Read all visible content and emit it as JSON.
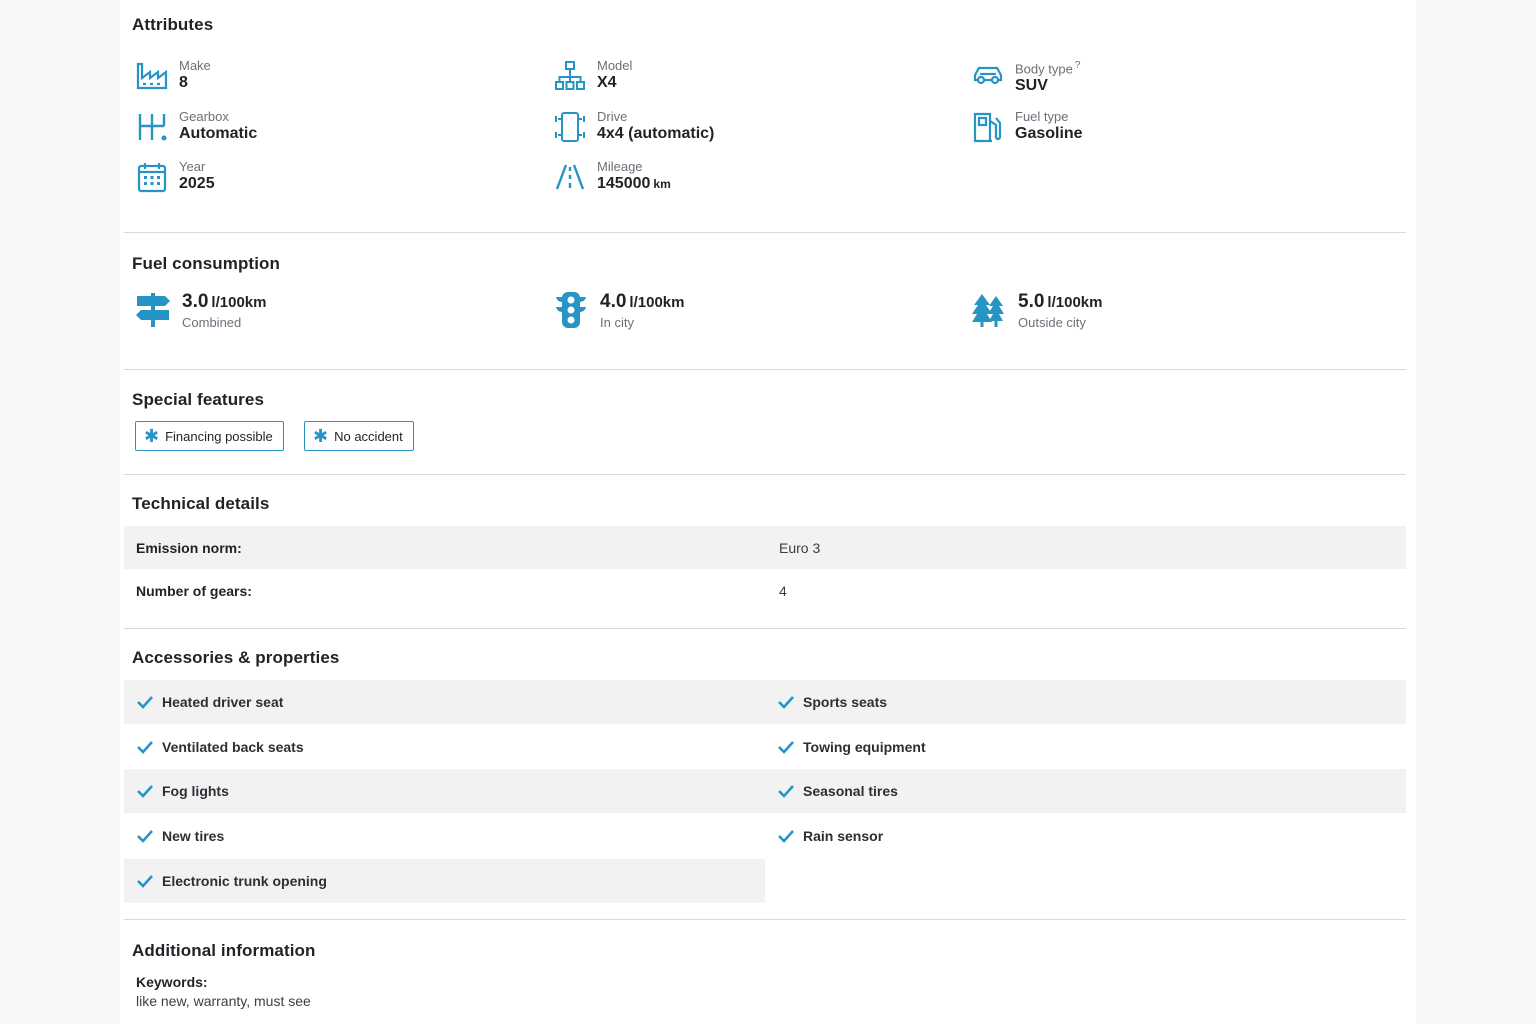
{
  "colors": {
    "accent": "#2694c4",
    "shade": "#f2f2f2",
    "divider": "#d6d9dd"
  },
  "attributes": {
    "title": "Attributes",
    "items": [
      {
        "icon": "factory-icon",
        "label": "Make",
        "value": "8"
      },
      {
        "icon": "hierarchy-icon",
        "label": "Model",
        "value": "X4"
      },
      {
        "icon": "car-icon",
        "label": "Body type",
        "value": "SUV",
        "help": "?"
      },
      {
        "icon": "gearbox-icon",
        "label": "Gearbox",
        "value": "Automatic"
      },
      {
        "icon": "drive-icon",
        "label": "Drive",
        "value": "4x4 (automatic)"
      },
      {
        "icon": "fuel-pump-icon",
        "label": "Fuel type",
        "value": "Gasoline"
      },
      {
        "icon": "calendar-icon",
        "label": "Year",
        "value": "2025"
      },
      {
        "icon": "road-icon",
        "label": "Mileage",
        "value": "145000",
        "unit": "km"
      }
    ]
  },
  "fuel": {
    "title": "Fuel consumption",
    "items": [
      {
        "icon": "signpost-icon",
        "value": "3.0",
        "unit": "l/100km",
        "label": "Combined"
      },
      {
        "icon": "traffic-light-icon",
        "value": "4.0",
        "unit": "l/100km",
        "label": "In city"
      },
      {
        "icon": "trees-icon",
        "value": "5.0",
        "unit": "l/100km",
        "label": "Outside city"
      }
    ]
  },
  "features": {
    "title": "Special features",
    "chips": [
      "Financing possible",
      "No accident"
    ]
  },
  "technical": {
    "title": "Technical details",
    "rows": [
      {
        "key": "Emission norm:",
        "value": "Euro 3"
      },
      {
        "key": "Number of gears:",
        "value": "4"
      }
    ]
  },
  "accessories": {
    "title": "Accessories & properties",
    "left": [
      "Heated driver seat",
      "Ventilated back seats",
      "Fog lights",
      "New tires",
      "Electronic trunk opening"
    ],
    "right": [
      "Sports seats",
      "Towing equipment",
      "Seasonal tires",
      "Rain sensor"
    ]
  },
  "additional": {
    "title": "Additional information",
    "keywords_label": "Keywords:",
    "keywords_value": "like new, warranty, must see"
  }
}
